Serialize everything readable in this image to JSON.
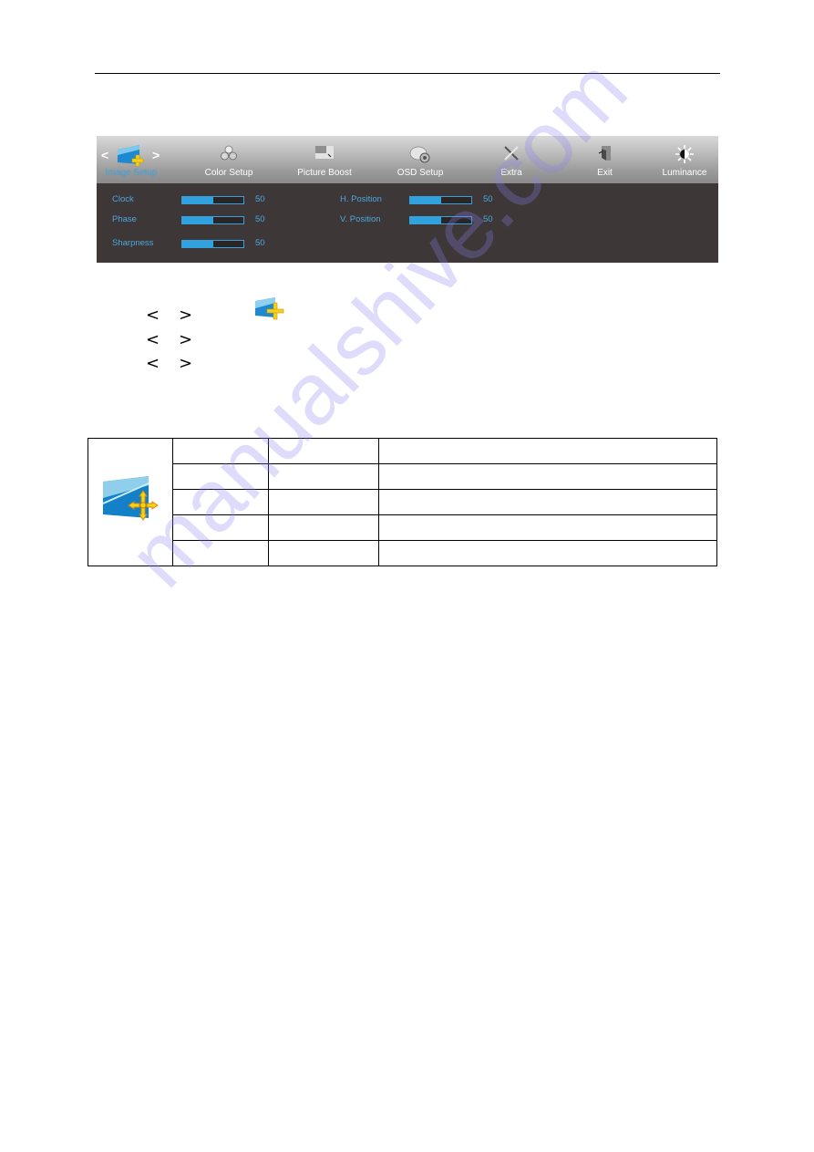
{
  "osd": {
    "tabs": [
      {
        "label": "Image Setup",
        "icon": "image-setup-icon",
        "active": true
      },
      {
        "label": "Color Setup",
        "icon": "color-setup-icon",
        "active": false
      },
      {
        "label": "Picture Boost",
        "icon": "picture-boost-icon",
        "active": false
      },
      {
        "label": "OSD Setup",
        "icon": "osd-setup-icon",
        "active": false
      },
      {
        "label": "Extra",
        "icon": "extra-icon",
        "active": false
      },
      {
        "label": "Exit",
        "icon": "exit-icon",
        "active": false
      },
      {
        "label": "Luminance",
        "icon": "luminance-icon",
        "active": false
      }
    ],
    "nav_left": "<",
    "nav_right": ">",
    "settings": [
      {
        "name": "Clock",
        "value": "50",
        "level": 0.5
      },
      {
        "name": "Phase",
        "value": "50",
        "level": 0.5
      },
      {
        "name": "Sharpness",
        "value": "50",
        "level": 0.5
      },
      {
        "name": "H. Position",
        "value": "50",
        "level": 0.5
      },
      {
        "name": "V. Position",
        "value": "50",
        "level": 0.5
      }
    ],
    "colors": {
      "accent": "#2fa3e0",
      "panel": "#3d3737",
      "label": "#4ea6e0"
    }
  },
  "instructions": [
    {
      "left": "<",
      "right": ">"
    },
    {
      "left": "<",
      "right": ">"
    },
    {
      "left": "<",
      "right": ">"
    }
  ],
  "table": {
    "icon": "image-setup-icon",
    "rows": [
      [
        "",
        "",
        ""
      ],
      [
        "",
        "",
        ""
      ],
      [
        "",
        "",
        ""
      ],
      [
        "",
        "",
        ""
      ],
      [
        "",
        "",
        ""
      ]
    ]
  },
  "watermark": "manualshive.com"
}
